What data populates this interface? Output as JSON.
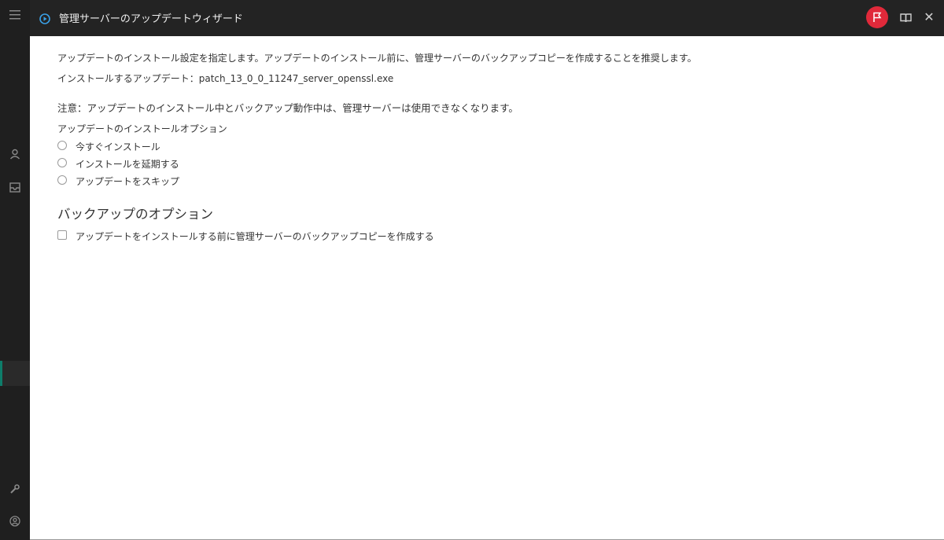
{
  "dialog": {
    "title": "管理サーバーのアップデートウィザード"
  },
  "content": {
    "intro": "アップデートのインストール設定を指定します。アップデートのインストール前に、管理サーバーのバックアップコピーを作成することを推奨します。",
    "patch_line": "インストールするアップデート：patch_13_0_0_11247_server_openssl.exe",
    "note": "注意：アップデートのインストール中とバックアップ動作中は、管理サーバーは使用できなくなります。",
    "install_options_heading": "アップデートのインストールオプション",
    "install_options": [
      {
        "label": "今すぐインストール",
        "selected": false
      },
      {
        "label": "インストールを延期する",
        "selected": false
      },
      {
        "label": "アップデートをスキップ",
        "selected": false
      }
    ],
    "backup_section_title": "バックアップのオプション",
    "backup_checkbox": {
      "label": "アップデートをインストールする前に管理サーバーのバックアップコピーを作成する",
      "checked": false
    }
  },
  "colors": {
    "header_bg": "#232323",
    "sidebar_bg": "#1f1f1f",
    "flag_button": "#e0293a",
    "play_icon": "#3aa0e6",
    "active_marker": "#0e7d6a"
  },
  "icons": {
    "sidebar": [
      "menu-icon",
      "user-icon",
      "tray-icon",
      "wrench-icon",
      "account-icon"
    ],
    "header": [
      "play-circle-icon",
      "flag-icon",
      "book-icon",
      "close-icon"
    ]
  }
}
